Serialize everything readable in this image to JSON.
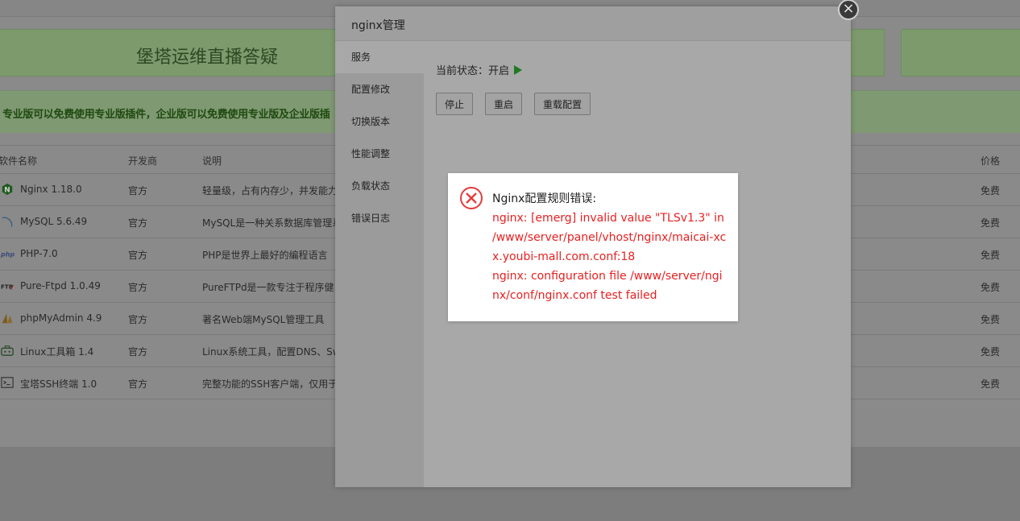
{
  "background": {
    "banner_title": "堡塔运维直播答疑",
    "notice": "专业版可以免费使用专业版插件，企业版可以免费使用专业版及企业版插",
    "table": {
      "headers": {
        "name": "软件名称",
        "developer": "开发商",
        "description": "说明",
        "price": "价格"
      },
      "rows": [
        {
          "icon": "nginx-icon",
          "name": "Nginx 1.18.0",
          "developer": "官方",
          "description": "轻量级，占有内存少，并发能力",
          "price": "免费"
        },
        {
          "icon": "mysql-dolphin-icon",
          "name": "MySQL 5.6.49",
          "developer": "官方",
          "description": "MySQL是一种关系数据库管理系",
          "price": "免费"
        },
        {
          "icon": "php-icon",
          "name": "PHP-7.0",
          "developer": "官方",
          "description": "PHP是世界上最好的编程语言",
          "price": "免费"
        },
        {
          "icon": "ftp-icon",
          "name": "Pure-Ftpd 1.0.49",
          "developer": "官方",
          "description": "PureFTPd是一款专注于程序健",
          "price": "免费"
        },
        {
          "icon": "phpmyadmin-icon",
          "name": "phpMyAdmin 4.9",
          "developer": "官方",
          "description": "著名Web端MySQL管理工具",
          "price": "免费"
        },
        {
          "icon": "toolbox-icon",
          "name": "Linux工具箱 1.4",
          "developer": "官方",
          "description": "Linux系统工具，配置DNS、Sw",
          "price": "免费"
        },
        {
          "icon": "terminal-icon",
          "name": "宝塔SSH终端 1.0",
          "developer": "官方",
          "description": "完整功能的SSH客户端，仅用于",
          "price": "免费"
        }
      ]
    }
  },
  "modal": {
    "title": "nginx管理",
    "close_symbol": "×",
    "sidebar": [
      "服务",
      "配置修改",
      "切换版本",
      "性能调整",
      "负载状态",
      "错误日志"
    ],
    "active_tab": "服务",
    "status_label": "当前状态：开启",
    "buttons": {
      "stop": "停止",
      "restart": "重启",
      "reload": "重载配置"
    }
  },
  "error_dialog": {
    "title": "Nginx配置规则错误:",
    "message": "nginx: [emerg] invalid value \"TLSv1.3\" in /www/server/panel/vhost/nginx/maicai-xcx.youbi-mall.com.conf:18",
    "message2": "nginx: configuration file /www/server/nginx/conf/nginx.conf test failed"
  },
  "colors": {
    "overlay": "#7d7d7d",
    "error_text": "#e82020",
    "running_green": "#1f7a1f"
  }
}
